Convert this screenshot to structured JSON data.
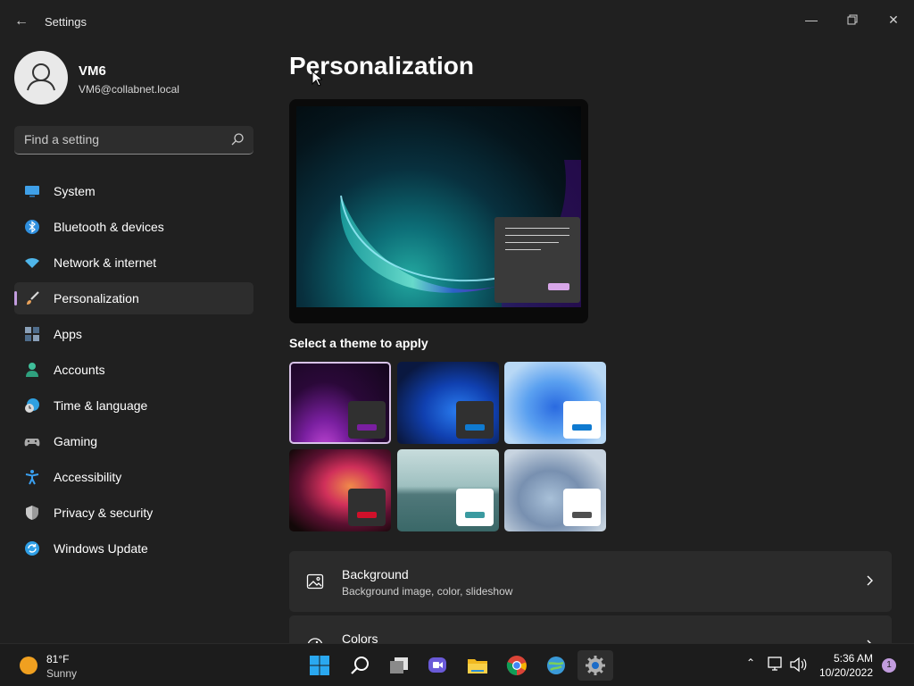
{
  "app": {
    "title": "Settings"
  },
  "profile": {
    "name": "VM6",
    "email": "VM6@collabnet.local"
  },
  "search": {
    "placeholder": "Find a setting"
  },
  "nav": [
    {
      "label": "System",
      "icon": "monitor-icon",
      "color": "#3fa0e8"
    },
    {
      "label": "Bluetooth & devices",
      "icon": "bluetooth-icon",
      "color": "#2f8fde"
    },
    {
      "label": "Network & internet",
      "icon": "wifi-icon",
      "color": "#4fb6ea"
    },
    {
      "label": "Personalization",
      "icon": "brush-icon",
      "color": "#e9a25a",
      "active": true
    },
    {
      "label": "Apps",
      "icon": "apps-icon",
      "color": "#8aa0b8"
    },
    {
      "label": "Accounts",
      "icon": "person-icon",
      "color": "#3fbf9a"
    },
    {
      "label": "Time & language",
      "icon": "globe-clock-icon",
      "color": "#2fa0e0"
    },
    {
      "label": "Gaming",
      "icon": "gamepad-icon",
      "color": "#a9a9a9"
    },
    {
      "label": "Accessibility",
      "icon": "accessibility-icon",
      "color": "#3aa0f0"
    },
    {
      "label": "Privacy & security",
      "icon": "shield-icon",
      "color": "#9a9a9a"
    },
    {
      "label": "Windows Update",
      "icon": "update-icon",
      "color": "#2f9fe6"
    }
  ],
  "main": {
    "title": "Personalization",
    "themes_label": "Select a theme to apply",
    "cards": [
      {
        "title": "Background",
        "subtitle": "Background image, color, slideshow",
        "icon": "image-icon"
      },
      {
        "title": "Colors",
        "subtitle": "",
        "icon": "palette-icon"
      }
    ]
  },
  "themes": [
    {
      "name": "theme-bloom-dark-purple",
      "selected": true,
      "bar": "#7a1fa0",
      "win": "#303030"
    },
    {
      "name": "theme-windows-dark",
      "bar": "#0f7ad0",
      "win": "#303030"
    },
    {
      "name": "theme-windows-light",
      "bar": "#0f7ad0",
      "win": "#ffffff"
    },
    {
      "name": "theme-glow",
      "bar": "#d0102a",
      "win": "#303030"
    },
    {
      "name": "theme-captured-motion",
      "bar": "#3a9aa0",
      "win": "#ffffff"
    },
    {
      "name": "theme-sunrise",
      "bar": "#505050",
      "win": "#ffffff"
    }
  ],
  "taskbar": {
    "weather": {
      "temp": "81°F",
      "condition": "Sunny"
    },
    "clock": {
      "time": "5:36 AM",
      "date": "10/20/2022"
    },
    "notifications": "1",
    "apps": [
      "start-icon",
      "search-icon",
      "task-view-icon",
      "teams-chat-icon",
      "file-explorer-icon",
      "chrome-icon",
      "network-tool-icon",
      "settings-icon"
    ]
  }
}
